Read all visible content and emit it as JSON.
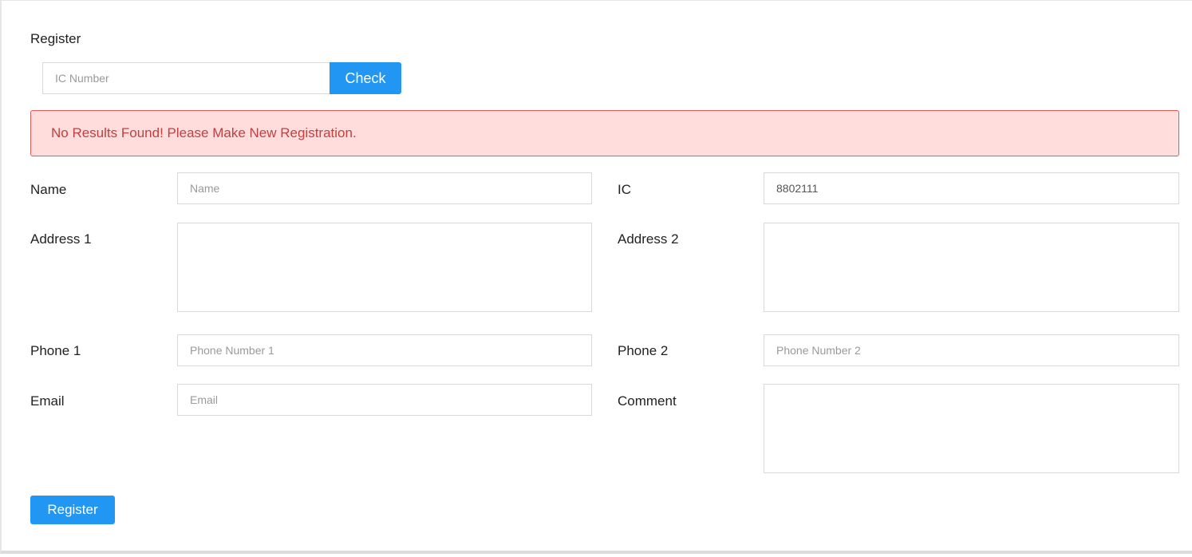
{
  "form": {
    "title": "Register",
    "ic_search": {
      "placeholder": "IC Number",
      "value": "",
      "button_label": "Check"
    },
    "alert": "No Results Found! Please Make New Registration.",
    "fields": {
      "name": {
        "label": "Name",
        "placeholder": "Name",
        "value": ""
      },
      "ic": {
        "label": "IC",
        "placeholder": "",
        "value": "8802111"
      },
      "address1": {
        "label": "Address 1",
        "value": ""
      },
      "address2": {
        "label": "Address 2",
        "value": ""
      },
      "phone1": {
        "label": "Phone 1",
        "placeholder": "Phone Number 1",
        "value": ""
      },
      "phone2": {
        "label": "Phone 2",
        "placeholder": "Phone Number 2",
        "value": ""
      },
      "email": {
        "label": "Email",
        "placeholder": "Email",
        "value": ""
      },
      "comment": {
        "label": "Comment",
        "value": ""
      }
    },
    "submit_label": "Register"
  },
  "colors": {
    "primary": "#2196f3",
    "alert_bg": "#ffdddd",
    "alert_border": "#e05a5a",
    "alert_text": "#c1413f"
  }
}
